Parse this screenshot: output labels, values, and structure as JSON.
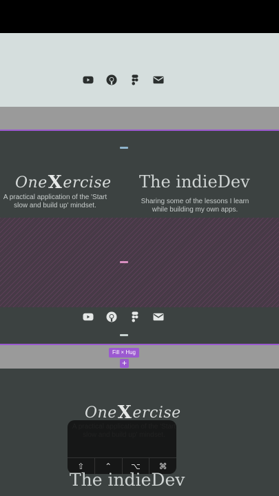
{
  "colors": {
    "light_section": "#d5dedd",
    "dark_section": "#3c4241",
    "gray_band": "#9a9a9a",
    "selection": "#9b59d0",
    "icon_dark": "#2b2f2e",
    "icon_light": "#e4e7e6"
  },
  "social_icons": [
    "youtube-icon",
    "github-icon",
    "figma-icon",
    "mail-icon"
  ],
  "projects": {
    "onexercise": {
      "logo_prefix": "One",
      "logo_x": "X",
      "logo_suffix": "ercise",
      "description": "A practical application of the 'Start slow and build up' mindset."
    },
    "indiedev": {
      "title": "The indieDev",
      "description": "Sharing some of the lessons I learn while building my own apps."
    }
  },
  "editor": {
    "fill_badge": "Fill × Hug",
    "add_label": "+"
  },
  "keyboard_keys": [
    "⇧",
    "⌃",
    "⌥",
    "⌘"
  ]
}
